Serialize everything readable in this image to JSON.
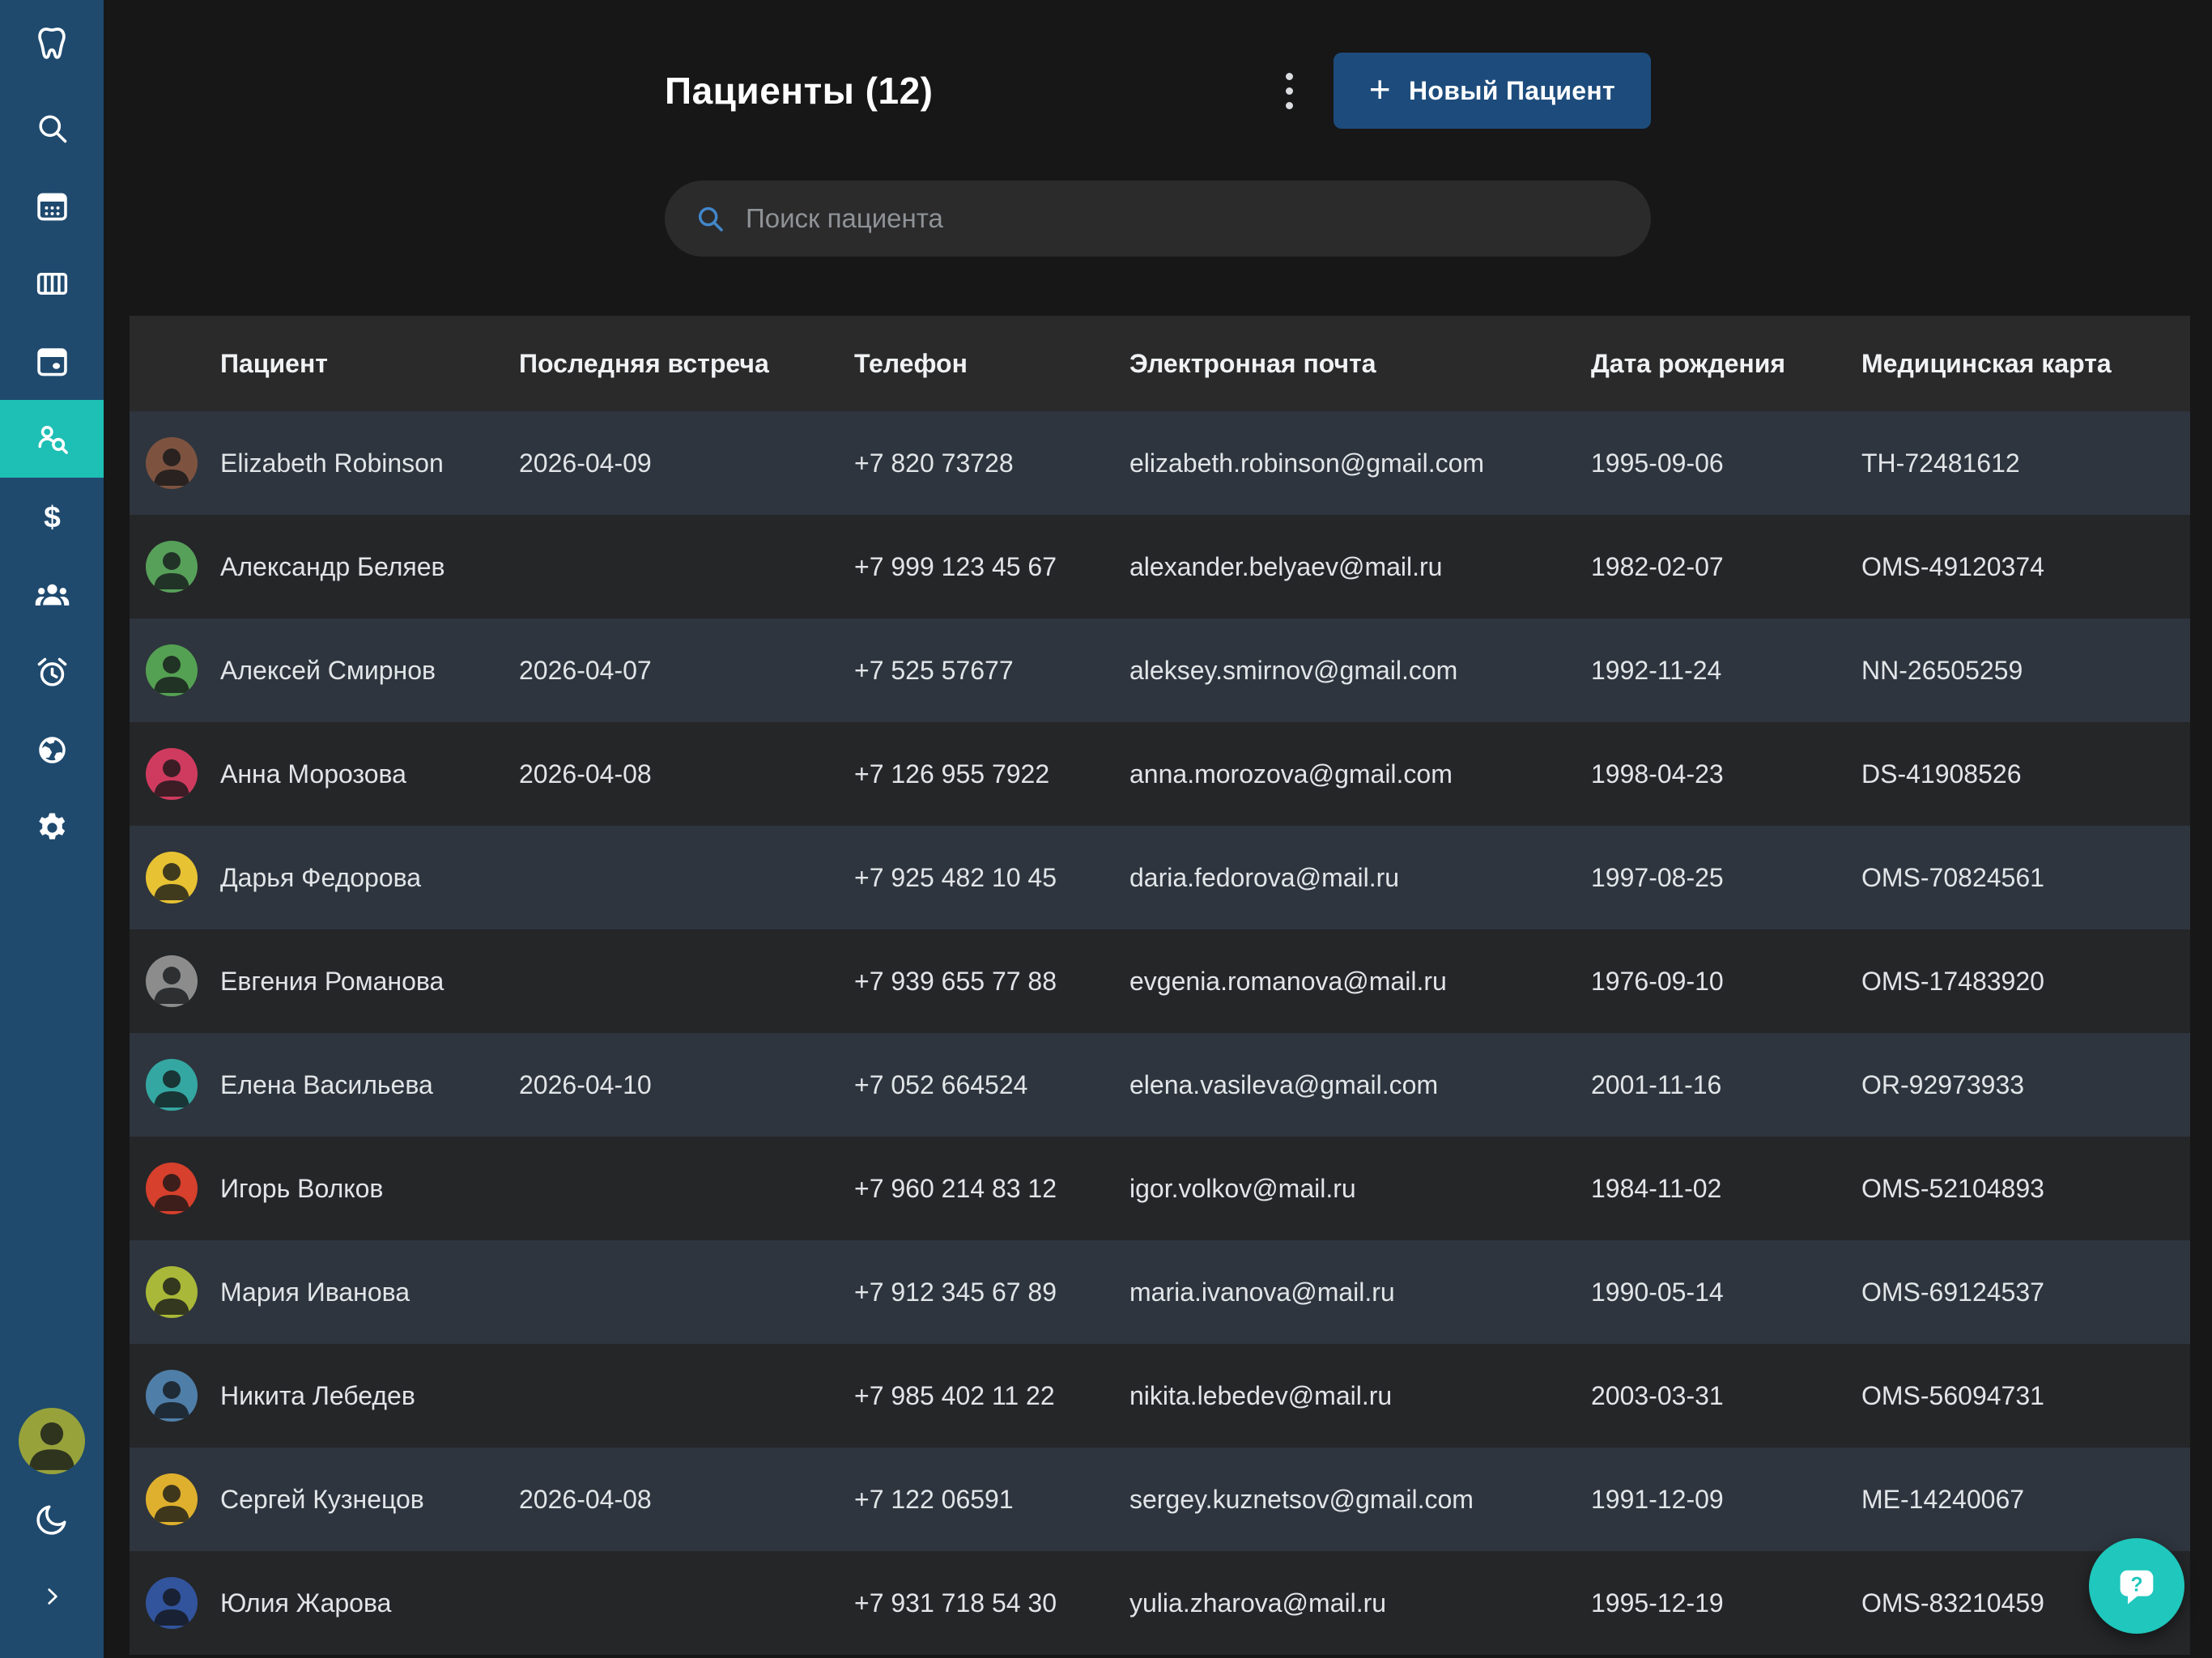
{
  "colors": {
    "sidebar_bg": "#1F4A6E",
    "sidebar_active_bg": "#1EBFB5",
    "page_bg": "#171718",
    "button_bg": "#1D4C7C",
    "search_bg": "#2B2B2C",
    "table_header_bg": "#2A2A2B",
    "row_light_bg": "#2E353E",
    "row_dark_bg": "#252628",
    "fab_bg": "#1FC7BD",
    "search_icon_blue": "#4287CA"
  },
  "sidebar": {
    "items": [
      {
        "icon": "tooth-logo",
        "name": "app-logo",
        "active": false,
        "interactable": false
      },
      {
        "icon": "search",
        "name": "sidebar-item-search",
        "active": false
      },
      {
        "icon": "calendar-grid",
        "name": "sidebar-item-calendar",
        "active": false
      },
      {
        "icon": "board-columns",
        "name": "sidebar-item-board",
        "active": false
      },
      {
        "icon": "calendar-event",
        "name": "sidebar-item-schedule",
        "active": false
      },
      {
        "icon": "patient-search",
        "name": "sidebar-item-patients",
        "active": true
      },
      {
        "icon": "dollar",
        "name": "sidebar-item-billing",
        "active": false
      },
      {
        "icon": "people-group",
        "name": "sidebar-item-staff",
        "active": false
      },
      {
        "icon": "alarm-clock",
        "name": "sidebar-item-reminders",
        "active": false
      },
      {
        "icon": "globe",
        "name": "sidebar-item-web",
        "active": false
      },
      {
        "icon": "gear",
        "name": "sidebar-item-settings",
        "active": false
      }
    ],
    "footer_items": [
      {
        "icon": "user-photo",
        "name": "user-avatar",
        "avatar_color": "#97A23B"
      },
      {
        "icon": "moon",
        "name": "dark-mode-toggle"
      },
      {
        "icon": "chevron-right",
        "name": "sidebar-expand-button"
      }
    ]
  },
  "header": {
    "title": "Пациенты (12)",
    "new_patient_label": "Новый Пациент",
    "plus_glyph": "+"
  },
  "search": {
    "placeholder": "Поиск пациента"
  },
  "table": {
    "columns": [
      "Пациент",
      "Последняя встреча",
      "Телефон",
      "Электронная почта",
      "Дата рождения",
      "Медицинская карта"
    ],
    "rows": [
      {
        "name": "Elizabeth Robinson",
        "last_visit": "2026-04-09",
        "phone": "+7 820 73728",
        "email": "elizabeth.robinson@gmail.com",
        "dob": "1995-09-06",
        "card": "TH-72481612",
        "avatar_color": "#7D5340"
      },
      {
        "name": "Александр Беляев",
        "last_visit": "",
        "phone": "+7 999 123 45 67",
        "email": "alexander.belyaev@mail.ru",
        "dob": "1982-02-07",
        "card": "OMS-49120374",
        "avatar_color": "#57A05A"
      },
      {
        "name": "Алексей Смирнов",
        "last_visit": "2026-04-07",
        "phone": "+7 525 57677",
        "email": "aleksey.smirnov@gmail.com",
        "dob": "1992-11-24",
        "card": "NN-26505259",
        "avatar_color": "#55A153"
      },
      {
        "name": "Анна Морозова",
        "last_visit": "2026-04-08",
        "phone": "+7 126 955 7922",
        "email": "anna.morozova@gmail.com",
        "dob": "1998-04-23",
        "card": "DS-41908526",
        "avatar_color": "#CF3B5E"
      },
      {
        "name": "Дарья Федорова",
        "last_visit": "",
        "phone": "+7 925 482 10 45",
        "email": "daria.fedorova@mail.ru",
        "dob": "1997-08-25",
        "card": "OMS-70824561",
        "avatar_color": "#E7C233"
      },
      {
        "name": "Евгения Романова",
        "last_visit": "",
        "phone": "+7 939 655 77 88",
        "email": "evgenia.romanova@mail.ru",
        "dob": "1976-09-10",
        "card": "OMS-17483920",
        "avatar_color": "#8C8C8C"
      },
      {
        "name": "Елена Васильева",
        "last_visit": "2026-04-10",
        "phone": "+7 052 664524",
        "email": "elena.vasileva@gmail.com",
        "dob": "2001-11-16",
        "card": "OR-92973933",
        "avatar_color": "#35A7A2"
      },
      {
        "name": "Игорь Волков",
        "last_visit": "",
        "phone": "+7 960 214 83 12",
        "email": "igor.volkov@mail.ru",
        "dob": "1984-11-02",
        "card": "OMS-52104893",
        "avatar_color": "#D6402C"
      },
      {
        "name": "Мария Иванова",
        "last_visit": "",
        "phone": "+7 912 345 67 89",
        "email": "maria.ivanova@mail.ru",
        "dob": "1990-05-14",
        "card": "OMS-69124537",
        "avatar_color": "#A9B838"
      },
      {
        "name": "Никита Лебедев",
        "last_visit": "",
        "phone": "+7 985 402 11 22",
        "email": "nikita.lebedev@mail.ru",
        "dob": "2003-03-31",
        "card": "OMS-56094731",
        "avatar_color": "#4F7FA8"
      },
      {
        "name": "Сергей Кузнецов",
        "last_visit": "2026-04-08",
        "phone": "+7 122 06591",
        "email": "sergey.kuznetsov@gmail.com",
        "dob": "1991-12-09",
        "card": "ME-14240067",
        "avatar_color": "#DFB02D"
      },
      {
        "name": "Юлия Жарова",
        "last_visit": "",
        "phone": "+7 931 718 54 30",
        "email": "yulia.zharova@mail.ru",
        "dob": "1995-12-19",
        "card": "OMS-83210459",
        "avatar_color": "#32549C"
      }
    ]
  },
  "fab": {
    "help_glyph": "?"
  }
}
